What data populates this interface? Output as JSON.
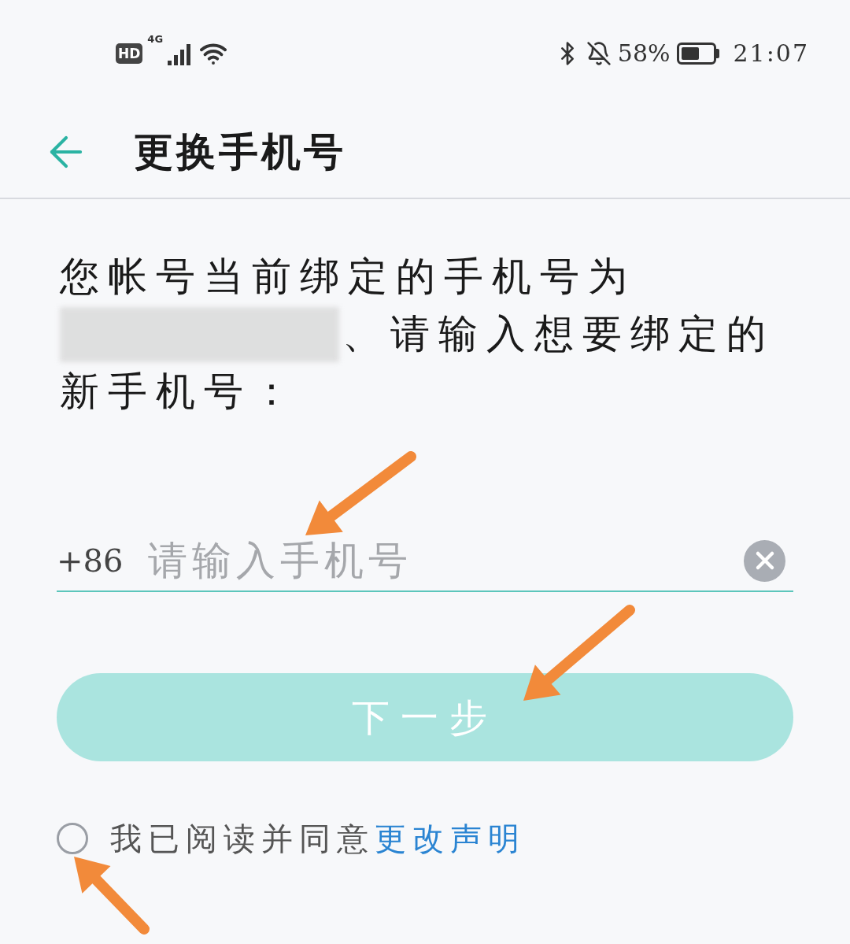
{
  "status_bar": {
    "hd": "HD",
    "network": "4G",
    "battery_percent": "58%",
    "time": "21:07"
  },
  "header": {
    "title": "更换手机号"
  },
  "instruction": {
    "before": "您帐号当前绑定的手机号为",
    "after": "、请输入想要绑定的",
    "after_continued": "新手机号："
  },
  "phone_input": {
    "prefix": "+86",
    "placeholder": "请输入手机号"
  },
  "next_button": {
    "label": "下一步",
    "disabled": true
  },
  "agreement": {
    "checked": false,
    "text": "我已阅读并同意",
    "link": "更改声明"
  }
}
